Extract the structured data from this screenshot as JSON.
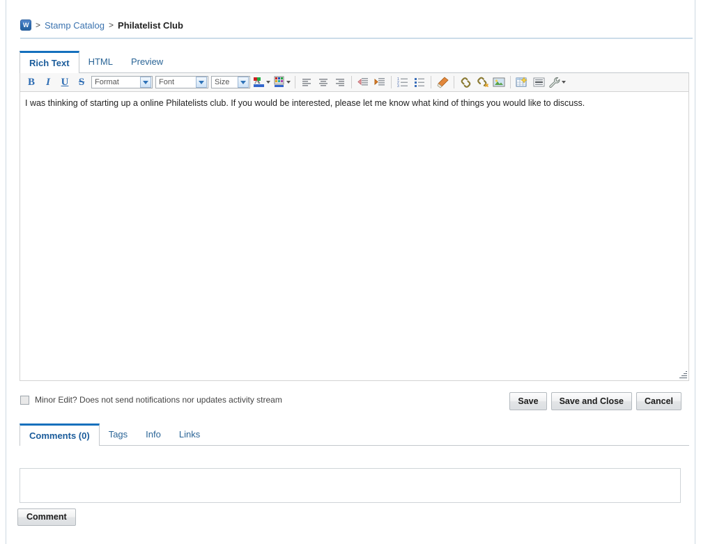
{
  "breadcrumb": {
    "icon": "wiki-w-icon",
    "separator": ">",
    "parent_label": "Stamp Catalog",
    "current_label": "Philatelist Club"
  },
  "editor_tabs": [
    {
      "label": "Rich Text",
      "active": true
    },
    {
      "label": "HTML",
      "active": false
    },
    {
      "label": "Preview",
      "active": false
    }
  ],
  "toolbar": {
    "bold_label": "B",
    "italic_label": "I",
    "underline_label": "U",
    "strike_label": "S",
    "format_select": "Format",
    "font_select": "Font",
    "size_select": "Size",
    "icons": [
      "text-color-icon",
      "background-color-icon",
      "align-left-icon",
      "align-center-icon",
      "align-right-icon",
      "outdent-icon",
      "indent-icon",
      "numbered-list-icon",
      "bulleted-list-icon",
      "remove-format-icon",
      "insert-link-icon",
      "unlink-icon",
      "insert-image-icon",
      "insert-table-icon",
      "horizontal-rule-icon",
      "tools-wrench-icon"
    ]
  },
  "editor": {
    "content": "I was thinking of starting up a online Philatelists  club. If you would be interested, please let me know what kind of things you would like to discuss."
  },
  "minor_edit": {
    "checked": false,
    "label": "Minor Edit? Does not send notifications nor updates activity stream"
  },
  "actions": {
    "save_label": "Save",
    "save_and_close_label": "Save and Close",
    "cancel_label": "Cancel"
  },
  "bottom_tabs": [
    {
      "label": "Comments (0)",
      "active": true
    },
    {
      "label": "Tags",
      "active": false
    },
    {
      "label": "Info",
      "active": false
    },
    {
      "label": "Links",
      "active": false
    }
  ],
  "comment": {
    "value": "",
    "placeholder": "",
    "button_label": "Comment"
  },
  "colors": {
    "accent": "#1570bd",
    "link": "#3b73af",
    "border": "#c3c8cc",
    "page_border": "#cdd9e2"
  }
}
